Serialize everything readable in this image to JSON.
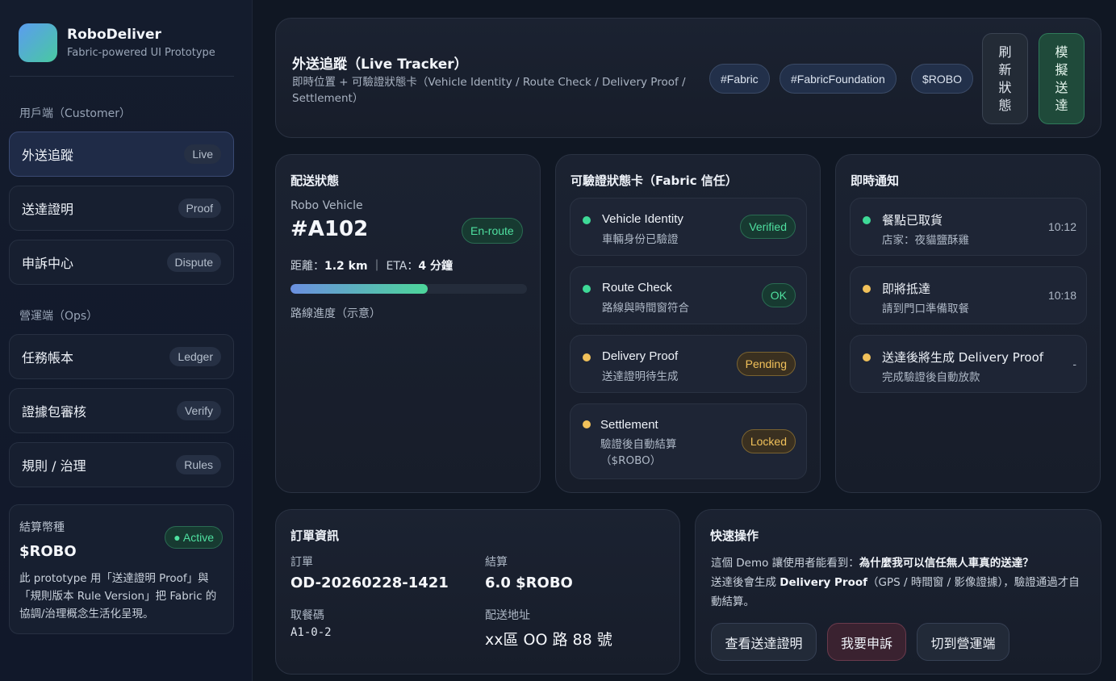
{
  "brand": {
    "title": "RoboDeliver",
    "subtitle": "Fabric-powered UI Prototype"
  },
  "sidebar": {
    "customer_section": "用戶端（Customer）",
    "ops_section": "營運端（Ops）",
    "customer_items": [
      {
        "label": "外送追蹤",
        "badge": "Live"
      },
      {
        "label": "送達證明",
        "badge": "Proof"
      },
      {
        "label": "申訴中心",
        "badge": "Dispute"
      }
    ],
    "ops_items": [
      {
        "label": "任務帳本",
        "badge": "Ledger"
      },
      {
        "label": "證據包審核",
        "badge": "Verify"
      },
      {
        "label": "規則 / 治理",
        "badge": "Rules"
      }
    ],
    "settlement": {
      "label": "結算幣種",
      "value": "$ROBO",
      "status": "● Active",
      "desc": "此 prototype 用「送達證明 Proof」與「規則版本 Rule Version」把 Fabric 的協調/治理概念生活化呈現。"
    }
  },
  "header": {
    "title": "外送追蹤（Live Tracker）",
    "subtitle": "即時位置 + 可驗證狀態卡（Vehicle Identity / Route Check / Delivery Proof / Settlement）",
    "tags": [
      "#Fabric",
      "#FabricFoundation",
      "$ROBO"
    ],
    "refresh_label": "刷新狀態",
    "simulate_label": "模擬送達"
  },
  "status": {
    "title": "配送狀態",
    "vehicle_label": "Robo Vehicle",
    "vehicle_id": "#A102",
    "state": "En-route",
    "distance_prefix": "距離：",
    "distance": "1.2 km",
    "eta_prefix": "｜ ETA：",
    "eta": "4 分鐘",
    "progress": 0.58,
    "progress_label": "路線進度（示意）"
  },
  "verify": {
    "title": "可驗證狀態卡（Fabric 信任）",
    "items": [
      {
        "title": "Vehicle Identity",
        "sub": "車輛身份已驗證",
        "badge": "Verified",
        "state": "green"
      },
      {
        "title": "Route Check",
        "sub": "路線與時間窗符合",
        "badge": "OK",
        "state": "green"
      },
      {
        "title": "Delivery Proof",
        "sub": "送達證明待生成",
        "badge": "Pending",
        "state": "yellow"
      },
      {
        "title": "Settlement",
        "sub": "驗證後自動結算（$ROBO）",
        "badge": "Locked",
        "state": "yellow"
      }
    ]
  },
  "notify": {
    "title": "即時通知",
    "items": [
      {
        "title": "餐點已取貨",
        "sub": "店家：夜貓鹽酥雞",
        "time": "10:12",
        "state": "green"
      },
      {
        "title": "即將抵達",
        "sub": "請到門口準備取餐",
        "time": "10:18",
        "state": "yellow"
      },
      {
        "title": "送達後將生成 Delivery Proof",
        "sub": "完成驗證後自動放款",
        "time": "-",
        "state": "yellow"
      }
    ]
  },
  "order": {
    "title": "訂單資訊",
    "order_label": "訂單",
    "order_id": "OD-20260228-1421",
    "settle_label": "結算",
    "settle_value": "6.0 $ROBO",
    "pickup_label": "取餐碼",
    "pickup_code": "A1-0-2",
    "address_label": "配送地址",
    "address": "xx區 OO 路 88 號"
  },
  "quick": {
    "title": "快速操作",
    "desc_line1_a": "這個 Demo 讓使用者能看到：",
    "desc_line1_b": "為什麼我可以信任無人車真的送達？",
    "desc_line2_a": "送達後會生成 ",
    "desc_line2_b": "Delivery Proof",
    "desc_line2_c": "（GPS / 時間窗 / 影像證據），驗證通過才自動結算。",
    "buttons": [
      "查看送達證明",
      "我要申訴",
      "切到營運端"
    ]
  },
  "colors": {
    "accent_green": "#4fe0a0",
    "accent_yellow": "#f1c15a",
    "background": "#101723"
  }
}
